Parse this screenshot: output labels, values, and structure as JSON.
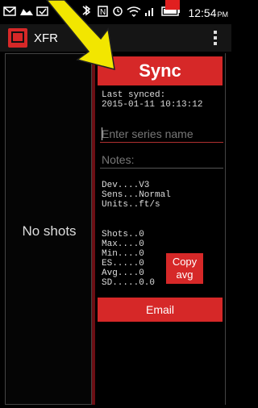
{
  "status_bar": {
    "time": "12:54",
    "ampm": "PM"
  },
  "app": {
    "title": "XFR"
  },
  "left_panel": {
    "empty_text": "No shots"
  },
  "sync": {
    "button_label": "Sync",
    "last_synced_label": "Last synced:",
    "last_synced_value": "2015-01-11 10:13:12"
  },
  "form": {
    "series_placeholder": "Enter series name",
    "notes_placeholder": "Notes:"
  },
  "device": {
    "dev": "Dev....V3",
    "sens": "Sens...Normal",
    "units": "Units..ft/s"
  },
  "stats": {
    "shots": "Shots..0",
    "max": "Max....0",
    "min": "Min....0",
    "es": "ES.....0",
    "avg": "Avg....0",
    "sd": "SD.....0.0"
  },
  "actions": {
    "copy_avg_line1": "Copy",
    "copy_avg_line2": "avg",
    "email_label": "Email"
  },
  "colors": {
    "accent": "#d62828",
    "arrow": "#f2e600"
  }
}
